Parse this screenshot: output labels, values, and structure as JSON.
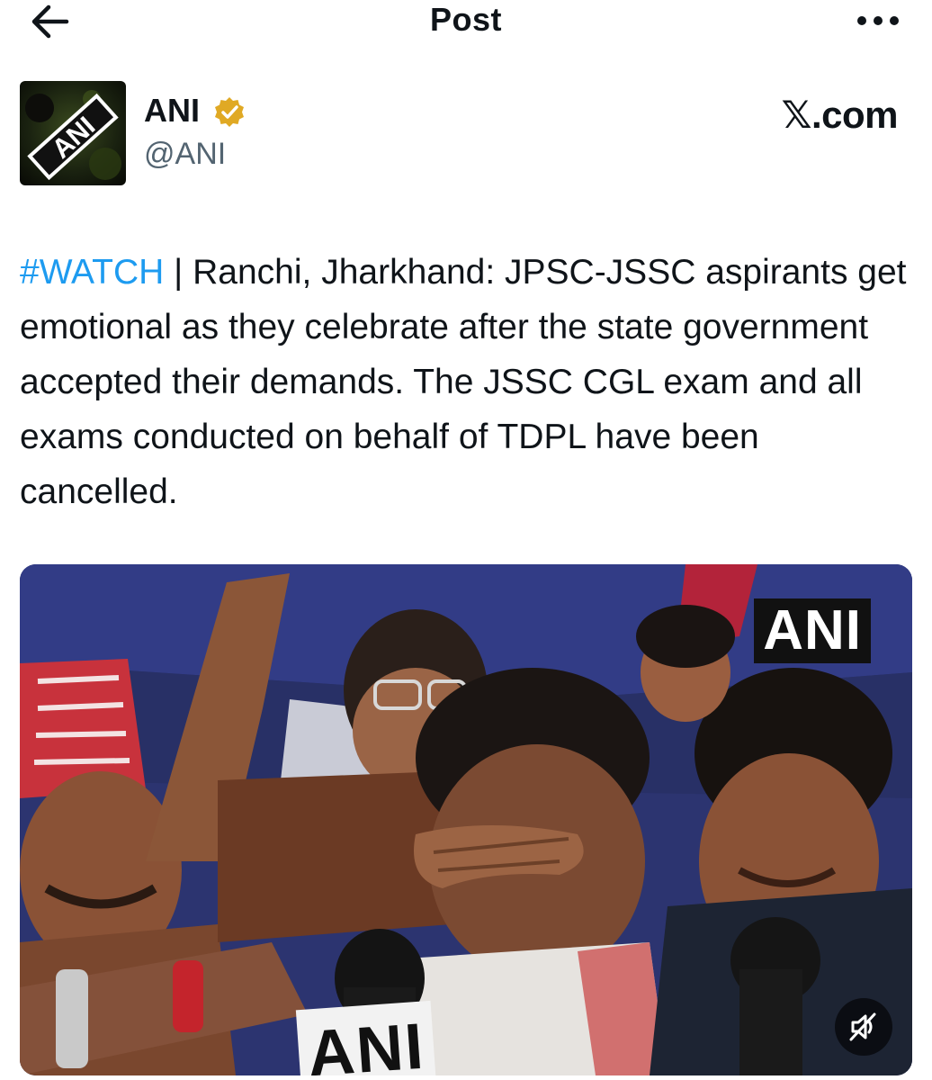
{
  "header": {
    "title": "Post",
    "back_icon": "arrow-left-icon",
    "more_icon": "more-horizontal-icon"
  },
  "author": {
    "name": "ANI",
    "handle": "@ANI",
    "verified": true,
    "verified_badge_color": "#e0a924",
    "avatar_logo_text": "ANI"
  },
  "site_label": "𝕏.com",
  "tweet": {
    "hashtag": "#WATCH",
    "body": " | Ranchi, Jharkhand: JPSC-JSSC aspirants get emotional as they celebrate after the state government accepted their demands. The JSSC CGL exam and all exams conducted on behalf of TDPL have been cancelled."
  },
  "media": {
    "watermark": "ANI",
    "mic_label": "ANI",
    "mute_icon": "speaker-muted-icon"
  },
  "colors": {
    "text": "#0f1419",
    "secondary": "#536471",
    "link": "#1d9bf0"
  }
}
